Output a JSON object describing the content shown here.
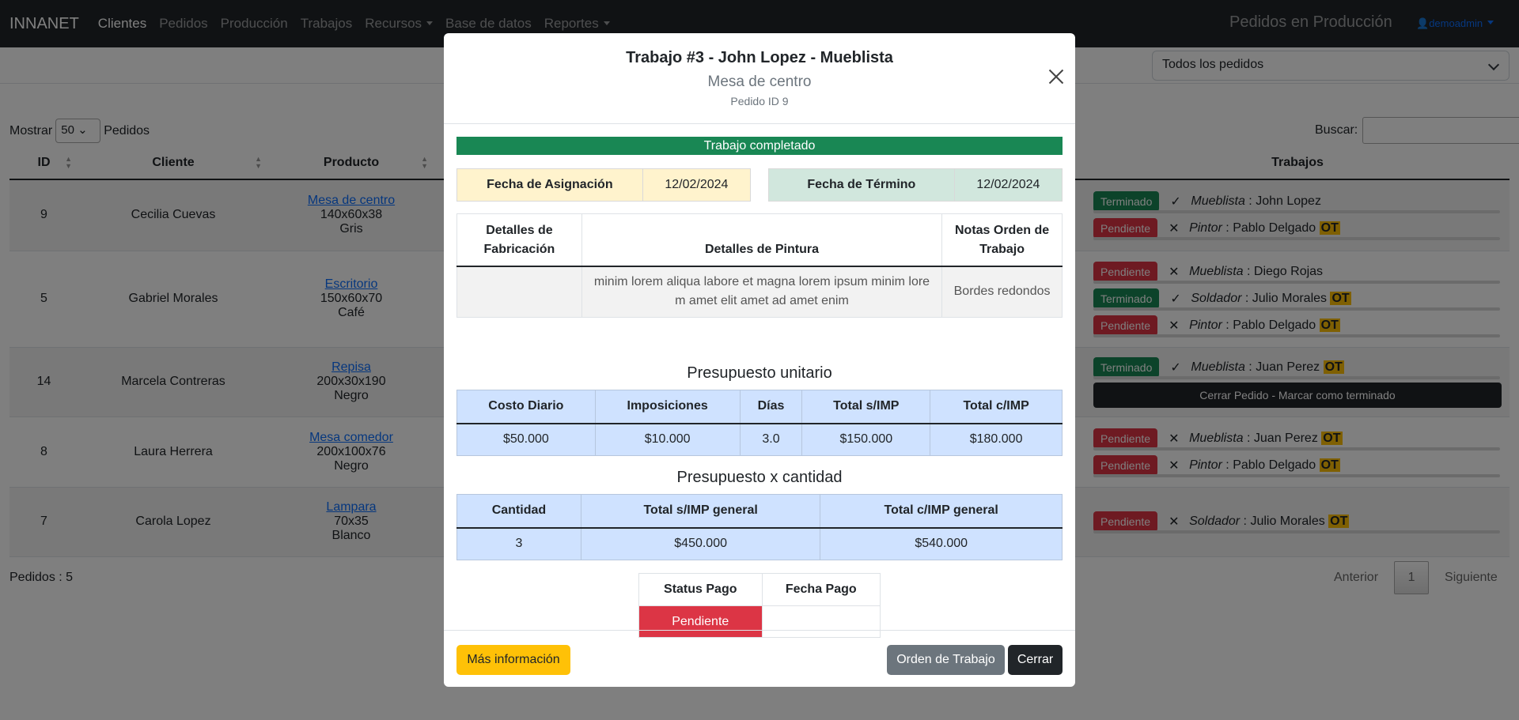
{
  "nav": {
    "brand": "INNANET",
    "items": [
      "Clientes",
      "Pedidos",
      "Producción",
      "Trabajos",
      "Recursos",
      "Base de datos",
      "Reportes"
    ],
    "page_title": "Pedidos en Producción",
    "user": "demoadmin"
  },
  "filter": {
    "selected": "Todos los pedidos"
  },
  "table_controls": {
    "show_label": "Mostrar",
    "show_value": "50",
    "show_suffix": "Pedidos",
    "search_label": "Buscar:"
  },
  "table": {
    "headers": {
      "id": "ID",
      "client": "Cliente",
      "product": "Producto",
      "jobs": "Trabajos"
    },
    "rows": [
      {
        "id": "9",
        "client": "Cecilia Cuevas",
        "product": "Mesa de centro",
        "dims": "140x60x38",
        "color": "Gris",
        "jobs": [
          {
            "status": "Terminado",
            "mark": "✓",
            "role": "Mueblista",
            "person": "John Lopez",
            "ot": ""
          },
          {
            "status": "Pendiente",
            "mark": "✕",
            "role": "Pintor",
            "person": "Pablo Delgado",
            "ot": "OT"
          }
        ]
      },
      {
        "id": "5",
        "client": "Gabriel Morales",
        "product": "Escritorio",
        "dims": "150x60x70",
        "color": "Café",
        "jobs": [
          {
            "status": "Pendiente",
            "mark": "✕",
            "role": "Mueblista",
            "person": "Diego Rojas",
            "ot": ""
          },
          {
            "status": "Terminado",
            "mark": "✓",
            "role": "Soldador",
            "person": "Julio Morales",
            "ot": "OT"
          },
          {
            "status": "Pendiente",
            "mark": "✕",
            "role": "Pintor",
            "person": "Pablo Delgado",
            "ot": "OT"
          }
        ]
      },
      {
        "id": "14",
        "client": "Marcela Contreras",
        "product": "Repisa",
        "dims": "200x30x190",
        "color": "Negro",
        "jobs": [
          {
            "status": "Terminado",
            "mark": "✓",
            "role": "Mueblista",
            "person": "Juan Perez",
            "ot": "OT"
          }
        ],
        "close_btn": "Cerrar Pedido - Marcar como terminado"
      },
      {
        "id": "8",
        "client": "Laura Herrera",
        "product": "Mesa comedor",
        "dims": "200x100x76",
        "color": "Negro",
        "jobs": [
          {
            "status": "Pendiente",
            "mark": "✕",
            "role": "Mueblista",
            "person": "Juan Perez",
            "ot": "OT"
          },
          {
            "status": "Pendiente",
            "mark": "✕",
            "role": "Pintor",
            "person": "Pablo Delgado",
            "ot": "OT"
          }
        ]
      },
      {
        "id": "7",
        "client": "Carola Lopez",
        "product": "Lampara",
        "dims": "70x35",
        "color": "Blanco",
        "jobs": [
          {
            "status": "Pendiente",
            "mark": "✕",
            "role": "Soldador",
            "person": "Julio Morales",
            "ot": "OT"
          }
        ]
      }
    ]
  },
  "footer": {
    "count": "Pedidos : 5",
    "prev": "Anterior",
    "page": "1",
    "next": "Siguiente"
  },
  "modal": {
    "title": "Trabajo #3 - John Lopez - Mueblista",
    "subtitle": "Mesa de centro",
    "order_id": "Pedido ID 9",
    "status": "Trabajo completado",
    "assign_label": "Fecha de Asignación",
    "assign_date": "12/02/2024",
    "end_label": "Fecha de Término",
    "end_date": "12/02/2024",
    "details": {
      "h_fab": "Detalles de Fabricación",
      "h_paint": "Detalles de Pintura",
      "h_notes": "Notas Orden de Trabajo",
      "fab": "",
      "paint": "minim lorem aliqua labore et magna lorem ipsum minim lore m amet elit amet ad amet enim",
      "notes": "Bordes redondos"
    },
    "unit_title": "Presupuesto unitario",
    "unit": {
      "headers": [
        "Costo Diario",
        "Imposiciones",
        "Días",
        "Total s/IMP",
        "Total c/IMP"
      ],
      "values": [
        "$50.000",
        "$10.000",
        "3.0",
        "$150.000",
        "$180.000"
      ]
    },
    "qty_title": "Presupuesto x cantidad",
    "qty": {
      "headers": [
        "Cantidad",
        "Total s/IMP general",
        "Total c/IMP general"
      ],
      "values": [
        "3",
        "$450.000",
        "$540.000"
      ]
    },
    "pay": {
      "h_status": "Status Pago",
      "h_date": "Fecha Pago",
      "status": "Pendiente",
      "date": ""
    },
    "buttons": {
      "more": "Más información",
      "ot": "Orden de Trabajo",
      "close": "Cerrar"
    }
  }
}
